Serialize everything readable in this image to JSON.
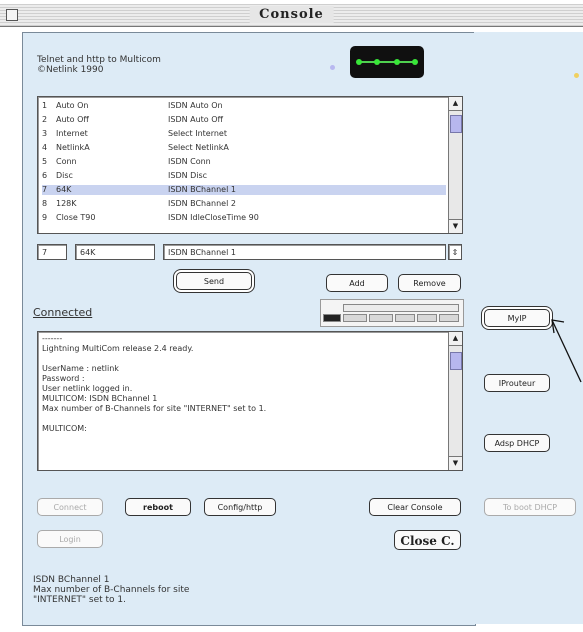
{
  "window": {
    "title": "Console"
  },
  "header": {
    "line1": "Telnet and http to Multicom",
    "line2": "©Netlink 1990"
  },
  "command_list": {
    "rows": [
      {
        "num": "1",
        "name": "Auto On",
        "command": "ISDN Auto On"
      },
      {
        "num": "2",
        "name": "Auto Off",
        "command": "ISDN Auto Off"
      },
      {
        "num": "3",
        "name": "Internet",
        "command": "Select Internet"
      },
      {
        "num": "4",
        "name": "NetlinkA",
        "command": "Select NetlinkA"
      },
      {
        "num": "5",
        "name": "Conn",
        "command": "ISDN Conn"
      },
      {
        "num": "6",
        "name": "Disc",
        "command": "ISDN Disc"
      },
      {
        "num": "7",
        "name": "64K",
        "command": "ISDN BChannel 1"
      },
      {
        "num": "8",
        "name": "128K",
        "command": "ISDN BChannel 2"
      },
      {
        "num": "9",
        "name": "Close T90",
        "command": "ISDN IdleCloseTime 90"
      }
    ],
    "selected_index": 6
  },
  "edit": {
    "number": "7",
    "name": "64K",
    "command": "ISDN BChannel 1"
  },
  "buttons": {
    "send": "Send",
    "add": "Add",
    "remove": "Remove",
    "connect": "Connect",
    "reboot": "reboot",
    "config_http": "Config/http",
    "clear_console": "Clear Console",
    "login": "Login",
    "close": "Close C.",
    "my_ip": "MyIP",
    "ip_routeur": "IProuteur",
    "adsp_dhcp": "Adsp DHCP",
    "to_boot_dhcp": "To boot DHCP"
  },
  "status": {
    "connected": "Connected"
  },
  "console_log": {
    "lines": [
      "-------",
      "Lightning MultiCom release 2.4 ready.",
      "",
      "UserName : netlink",
      "Password :",
      "User netlink logged in.",
      "MULTICOM: ISDN BChannel 1",
      "Max number of B-Channels for site \"INTERNET\" set to 1.",
      "",
      "MULTICOM:"
    ]
  },
  "footer": {
    "lines": [
      "ISDN BChannel 1",
      "Max number of B-Channels for site",
      "\"INTERNET\" set to 1."
    ]
  },
  "colors": {
    "panel": "#ddebf6",
    "selection": "#c9d3f0",
    "led": "#39e639",
    "dot_purple": "#b8b8f0",
    "dot_yellow": "#f0d060"
  }
}
